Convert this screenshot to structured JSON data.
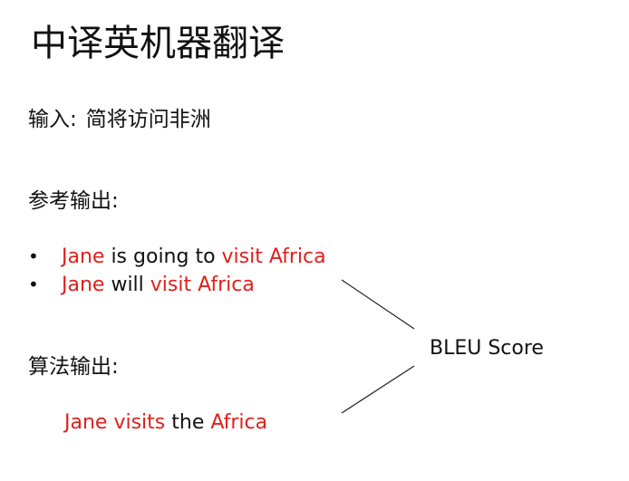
{
  "title": "中译英机器翻译",
  "input": {
    "label": "输入:",
    "text": "简将访问非洲"
  },
  "reference": {
    "label": "参考输出:",
    "items": [
      {
        "segments": [
          {
            "text": "Jane",
            "highlight": true
          },
          {
            "text": " is going to ",
            "highlight": false
          },
          {
            "text": "visit Africa",
            "highlight": true
          }
        ]
      },
      {
        "segments": [
          {
            "text": "Jane",
            "highlight": true
          },
          {
            "text": " will ",
            "highlight": false
          },
          {
            "text": "visit Africa",
            "highlight": true
          }
        ]
      }
    ]
  },
  "algorithm": {
    "label": "算法输出:",
    "segments": [
      {
        "text": "Jane visits",
        "highlight": true
      },
      {
        "text": " the ",
        "highlight": false
      },
      {
        "text": "Africa",
        "highlight": true
      }
    ]
  },
  "metric": {
    "label": "BLEU Score"
  },
  "colors": {
    "highlight": "#e0201b",
    "text": "#111111",
    "connector": "#222222"
  }
}
